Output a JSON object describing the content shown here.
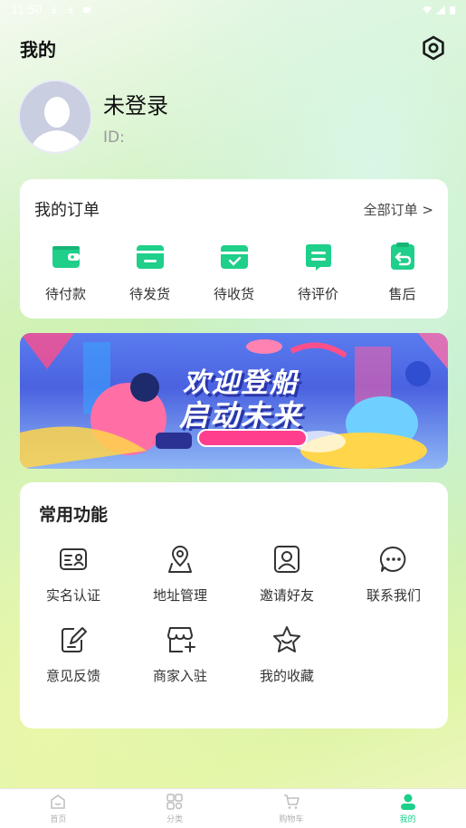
{
  "status_bar": {
    "time": "11:50"
  },
  "header": {
    "title": "我的"
  },
  "profile": {
    "login_status": "未登录",
    "id_label": "ID:"
  },
  "orders": {
    "title": "我的订单",
    "all_orders": "全部订单 >",
    "items": [
      {
        "label": "待付款",
        "icon": "wallet-icon"
      },
      {
        "label": "待发货",
        "icon": "package-icon"
      },
      {
        "label": "待收货",
        "icon": "box-check-icon"
      },
      {
        "label": "待评价",
        "icon": "comment-icon"
      },
      {
        "label": "售后",
        "icon": "return-icon"
      }
    ]
  },
  "banner": {
    "line1": "欢迎登船",
    "line2": "启动未来"
  },
  "functions": {
    "title": "常用功能",
    "items": [
      {
        "label": "实名认证",
        "icon": "id-card-icon"
      },
      {
        "label": "地址管理",
        "icon": "location-icon"
      },
      {
        "label": "邀请好友",
        "icon": "user-invite-icon"
      },
      {
        "label": "联系我们",
        "icon": "chat-icon"
      },
      {
        "label": "意见反馈",
        "icon": "feedback-icon"
      },
      {
        "label": "商家入驻",
        "icon": "store-icon"
      },
      {
        "label": "我的收藏",
        "icon": "star-icon"
      }
    ]
  },
  "tabbar": {
    "items": [
      {
        "label": "首页",
        "icon": "home-icon"
      },
      {
        "label": "分类",
        "icon": "category-icon"
      },
      {
        "label": "购物车",
        "icon": "cart-icon"
      },
      {
        "label": "我的",
        "icon": "profile-icon",
        "active": true
      }
    ]
  },
  "colors": {
    "accent": "#1ccf8b",
    "icon_stroke": "#333333"
  }
}
